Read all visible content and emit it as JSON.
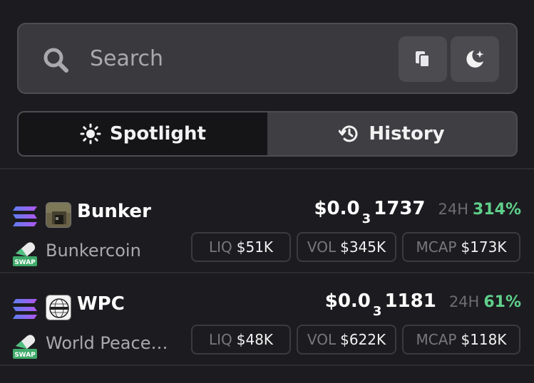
{
  "search": {
    "placeholder": "Search",
    "icon": "search-icon"
  },
  "buttons": {
    "copy_icon": "clipboard-icon",
    "theme_icon": "moon-star-icon"
  },
  "tabs": [
    {
      "label": "Spotlight",
      "icon": "sun-icon",
      "active": true
    },
    {
      "label": "History",
      "icon": "history-icon",
      "active": false
    }
  ],
  "tokens": [
    {
      "symbol": "Bunker",
      "name": "Bunkercoin",
      "chain_icon": "solana-icon",
      "dex_badge": "SWAP",
      "price_prefix": "$0.0",
      "price_zeros": "3",
      "price_digits": "1737",
      "change_label": "24H",
      "change_value": "314%",
      "liq_label": "LIQ",
      "liq_value": "$51K",
      "vol_label": "VOL",
      "vol_value": "$345K",
      "mcap_label": "MCAP",
      "mcap_value": "$173K"
    },
    {
      "symbol": "WPC",
      "name": "World Peace…",
      "chain_icon": "solana-icon",
      "dex_badge": "SWAP",
      "price_prefix": "$0.0",
      "price_zeros": "3",
      "price_digits": "1181",
      "change_label": "24H",
      "change_value": "61%",
      "liq_label": "LIQ",
      "liq_value": "$48K",
      "vol_label": "VOL",
      "vol_value": "$622K",
      "mcap_label": "MCAP",
      "mcap_value": "$118K"
    }
  ],
  "colors": {
    "positive": "#5fd08a",
    "background": "#1c1c20"
  }
}
